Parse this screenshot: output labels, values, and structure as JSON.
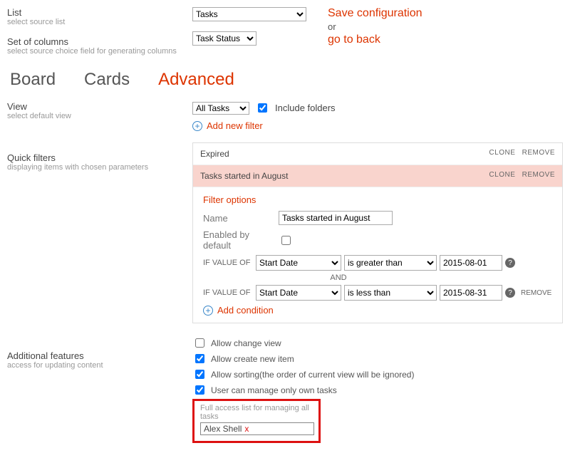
{
  "list": {
    "label": "List",
    "hint": "select source list",
    "select": "Tasks"
  },
  "cols": {
    "label": "Set of columns",
    "hint": "select source choice field for generating columns",
    "select": "Task Status"
  },
  "header_actions": {
    "save": "Save configuration",
    "or": "or",
    "back": "go to back"
  },
  "tabs": {
    "board": "Board",
    "cards": "Cards",
    "advanced": "Advanced"
  },
  "view": {
    "label": "View",
    "hint": "select default view",
    "select": "All Tasks",
    "include": "Include folders"
  },
  "addfilter": "Add new filter",
  "qf": {
    "label": "Quick filters",
    "hint": "displaying items with chosen parameters"
  },
  "filters": [
    {
      "name": "Expired",
      "selected": false
    },
    {
      "name": "Tasks started in August",
      "selected": true
    }
  ],
  "actions": {
    "clone": "CLONE",
    "remove": "REMOVE"
  },
  "opts": {
    "title": "Filter options",
    "name_label": "Name",
    "name_value": "Tasks started in August",
    "enabled_label": "Enabled by default",
    "ifvalue": "IF VALUE OF",
    "field": "Start Date",
    "op1": "is greater than",
    "val1": "2015-08-01",
    "and": "AND",
    "op2": "is less than",
    "val2": "2015-08-31",
    "remove": "REMOVE",
    "addcond": "Add condition"
  },
  "af": {
    "label": "Additional features",
    "hint": "access for updating content"
  },
  "checks": {
    "changeview": "Allow change view",
    "create": "Allow create new item",
    "sort": "Allow sorting(the order of current view will be ignored)",
    "own": "User can manage only own tasks",
    "fullhint": "Full access list for managing all tasks",
    "user": "Alex Shell"
  }
}
